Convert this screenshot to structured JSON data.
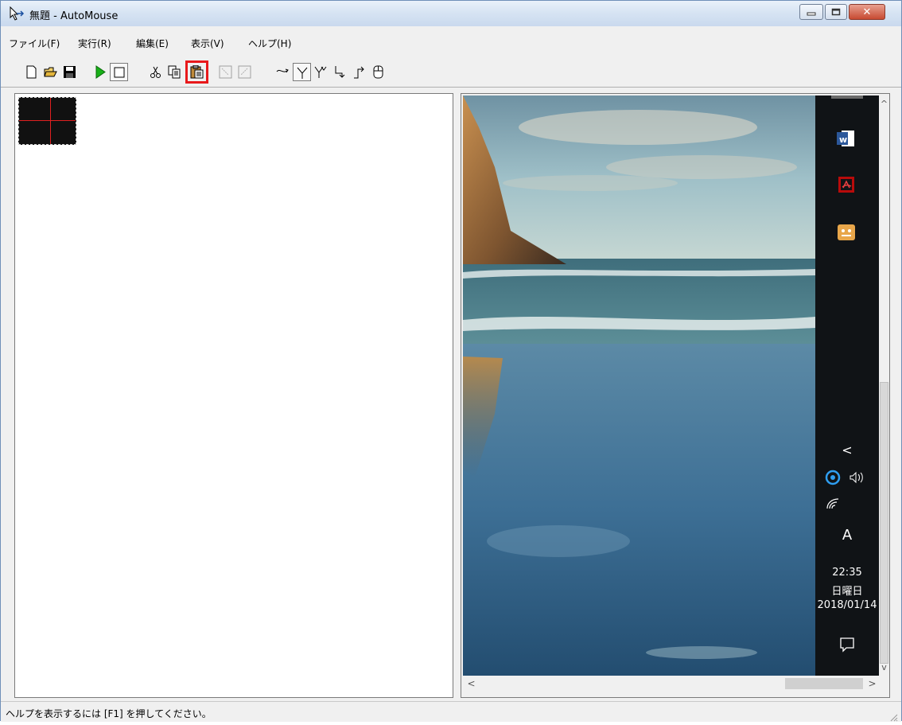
{
  "window": {
    "title": "無題 - AutoMouse",
    "close_label": "✕"
  },
  "menu": [
    {
      "label": "ファイル(F)"
    },
    {
      "label": "実行(R)"
    },
    {
      "label": "編集(E)"
    },
    {
      "label": "表示(V)"
    },
    {
      "label": "ヘルプ(H)"
    }
  ],
  "toolbar": {
    "buttons": [
      {
        "icon": "new-file-icon"
      },
      {
        "icon": "open-folder-icon"
      },
      {
        "icon": "save-icon"
      },
      {
        "icon": "play-icon"
      },
      {
        "icon": "stop-icon",
        "state": "pressed"
      },
      {
        "icon": "cut-icon"
      },
      {
        "icon": "copy-icon"
      },
      {
        "icon": "paste-icon",
        "state": "highlighted"
      },
      {
        "icon": "zoom-in-icon",
        "state": "disabled"
      },
      {
        "icon": "zoom-out-icon",
        "state": "disabled"
      },
      {
        "icon": "mouse-move-icon"
      },
      {
        "icon": "left-click-icon",
        "state": "pressed"
      },
      {
        "icon": "double-click-icon"
      },
      {
        "icon": "drag-down-icon"
      },
      {
        "icon": "drag-up-icon"
      },
      {
        "icon": "mouse-button-icon"
      }
    ],
    "highlight_color": "#e8191b"
  },
  "preview": {
    "taskbar": {
      "time": "22:35",
      "day": "日曜日",
      "date": "2018/01/14",
      "ime_label": "A",
      "chevron": "<"
    }
  },
  "status": {
    "text": "ヘルプを表示するには [F1] を押してください。"
  }
}
